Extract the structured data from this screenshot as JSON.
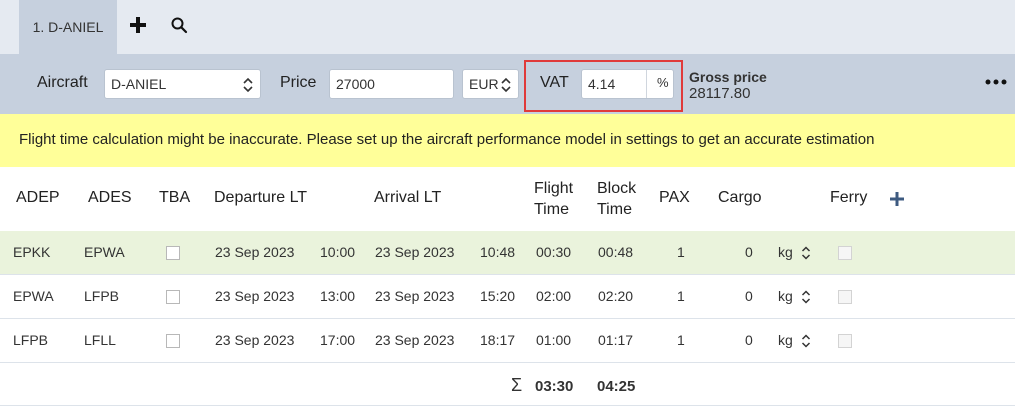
{
  "tabs": [
    {
      "label": "1. D-ANIEL"
    }
  ],
  "toolbar": {
    "aircraft_label": "Aircraft",
    "aircraft_value": "D-ANIEL",
    "price_label": "Price",
    "price_value": "27000",
    "currency_value": "EUR",
    "vat_label": "VAT",
    "vat_value": "4.14",
    "vat_unit": "%",
    "gross_label": "Gross price",
    "gross_value": "28117.80"
  },
  "warning": "Flight time calculation might be inaccurate. Please set up the aircraft performance model in settings to get an accurate estimation",
  "columns": {
    "adep": "ADEP",
    "ades": "ADES",
    "tba": "TBA",
    "departure": "Departure LT",
    "arrival": "Arrival LT",
    "flight_time_1": "Flight",
    "flight_time_2": "Time",
    "block_time_1": "Block",
    "block_time_2": "Time",
    "pax": "PAX",
    "cargo": "Cargo",
    "ferry": "Ferry"
  },
  "rows": [
    {
      "adep": "EPKK",
      "ades": "EPWA",
      "dep_date": "23 Sep 2023",
      "dep_time": "10:00",
      "arr_date": "23 Sep 2023",
      "arr_time": "10:48",
      "flight_time": "00:30",
      "block_time": "00:48",
      "pax": "1",
      "cargo": "0",
      "cargo_unit": "kg"
    },
    {
      "adep": "EPWA",
      "ades": "LFPB",
      "dep_date": "23 Sep 2023",
      "dep_time": "13:00",
      "arr_date": "23 Sep 2023",
      "arr_time": "15:20",
      "flight_time": "02:00",
      "block_time": "02:20",
      "pax": "1",
      "cargo": "0",
      "cargo_unit": "kg"
    },
    {
      "adep": "LFPB",
      "ades": "LFLL",
      "dep_date": "23 Sep 2023",
      "dep_time": "17:00",
      "arr_date": "23 Sep 2023",
      "arr_time": "18:17",
      "flight_time": "01:00",
      "block_time": "01:17",
      "pax": "1",
      "cargo": "0",
      "cargo_unit": "kg"
    }
  ],
  "totals": {
    "symbol": "Σ",
    "flight_time": "03:30",
    "block_time": "04:25"
  },
  "icons": {
    "add": "plus-icon",
    "search": "search-icon",
    "more": "more-icon",
    "add_row": "plus-icon",
    "stepper": "chevron-updown-icon"
  },
  "colors": {
    "accent": "#3d5a80",
    "highlight_border": "#e03a3a",
    "warning_bg": "#ffff99",
    "row_highlight": "#eaf3dc"
  }
}
